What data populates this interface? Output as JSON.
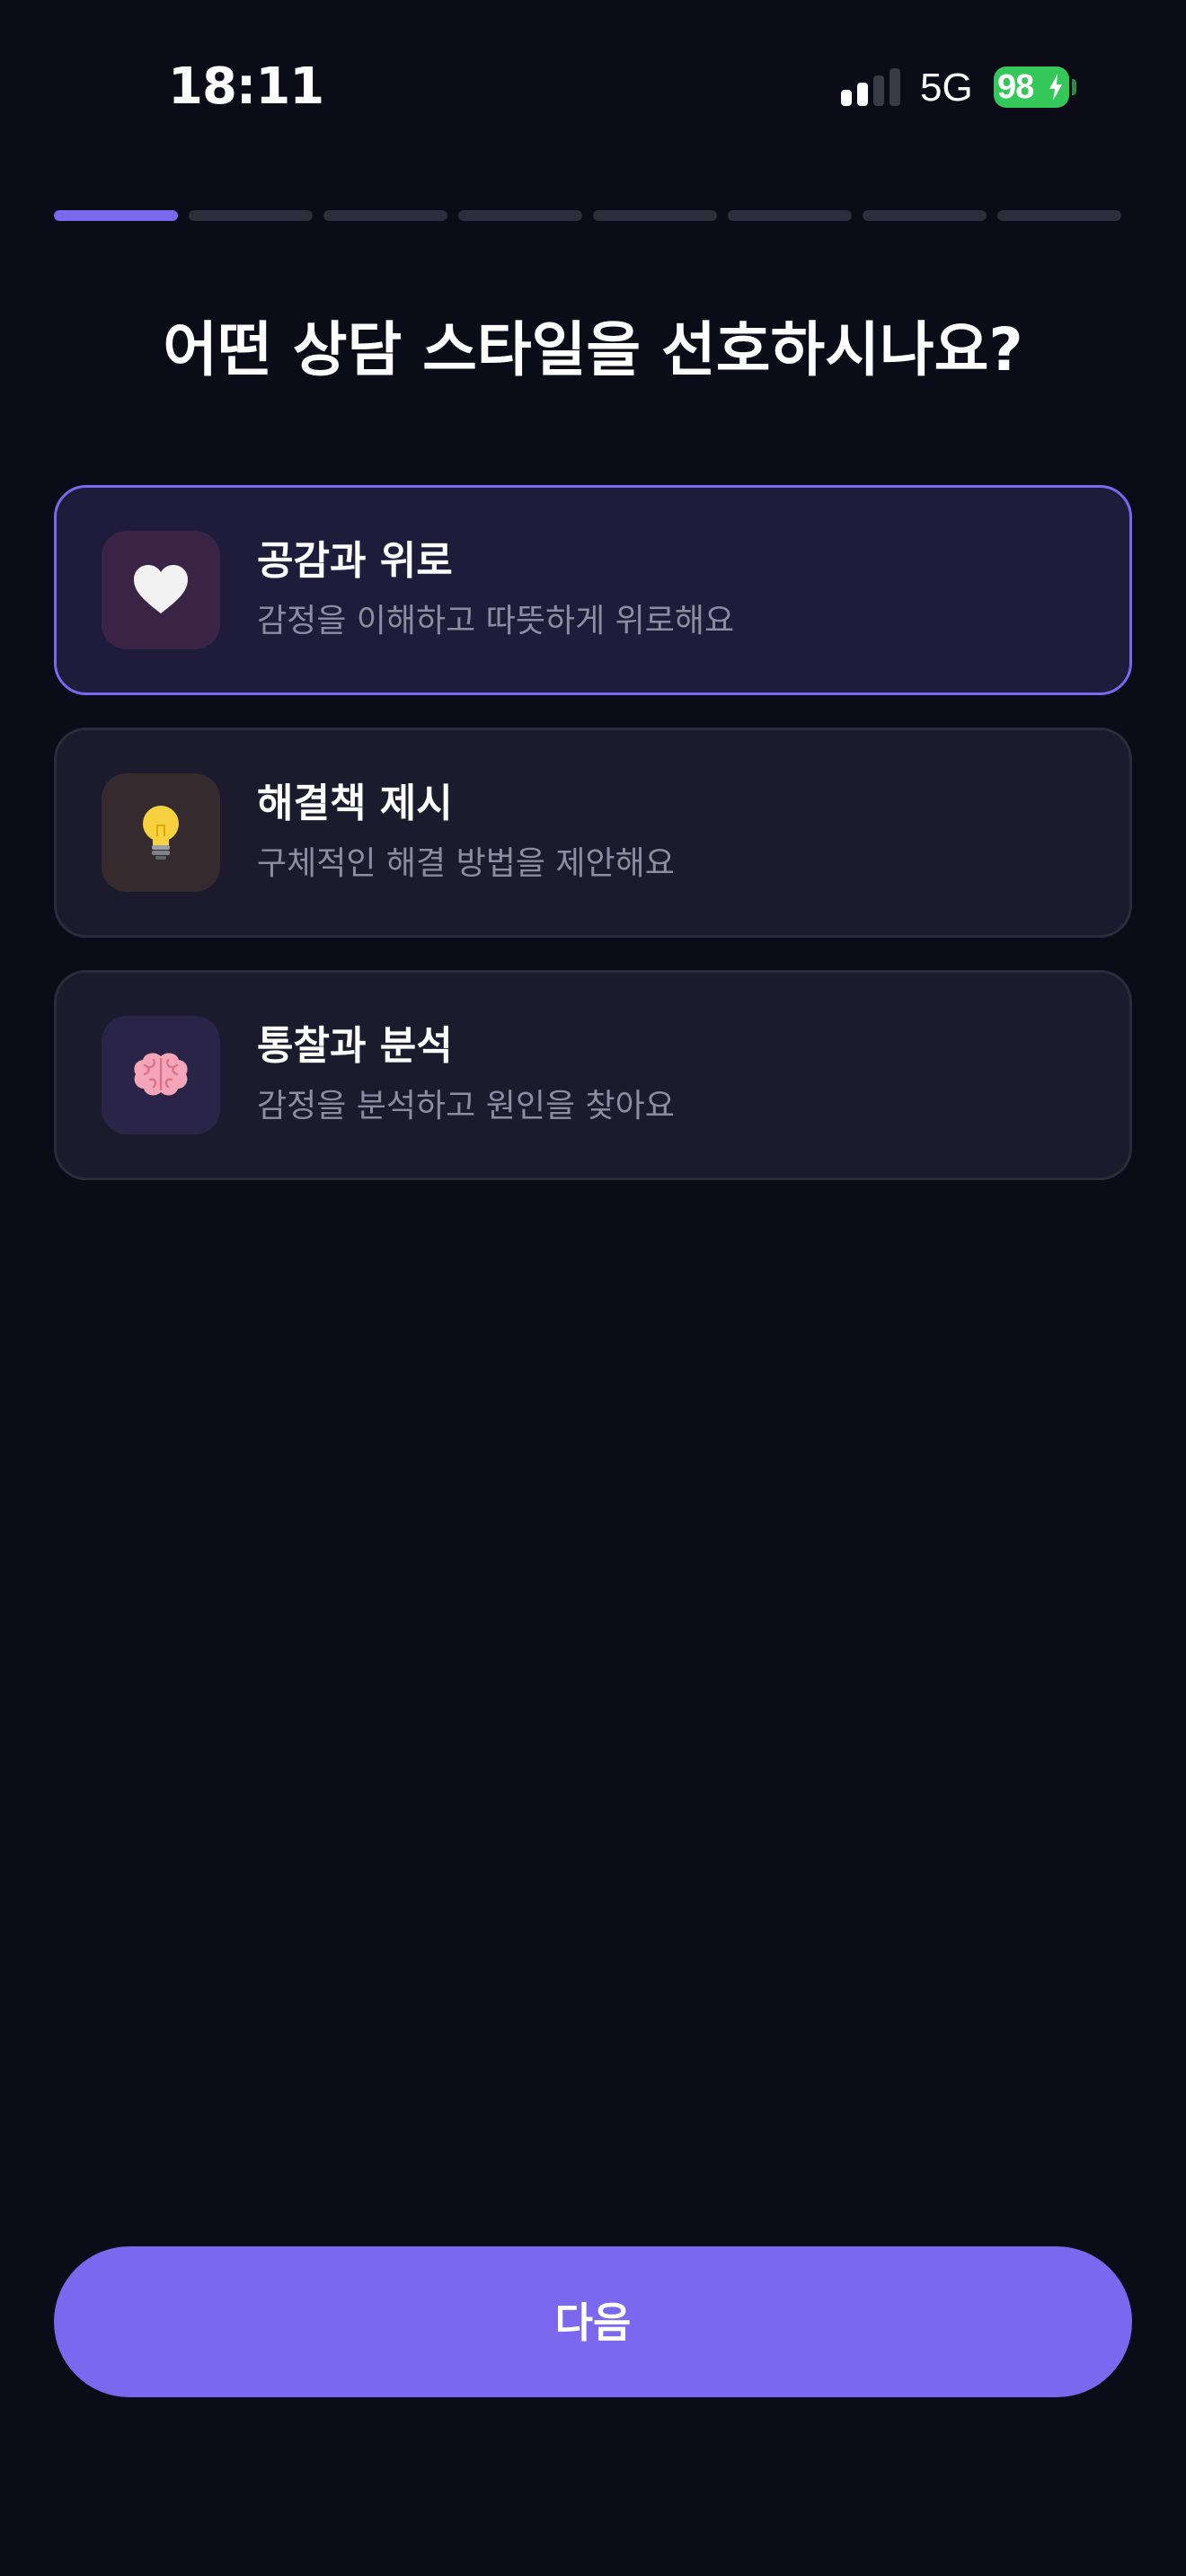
{
  "status_bar": {
    "time": "18:11",
    "network": "5G",
    "battery": "98",
    "signal_bars_active": 2,
    "signal_bars_total": 4
  },
  "progress": {
    "total_steps": 8,
    "current_step": 1
  },
  "question": "어떤 상담 스타일을 선호하시나요?",
  "options": [
    {
      "title": "공감과 위로",
      "description": "감정을 이해하고 따뜻하게 위로해요",
      "icon": "white-heart-icon",
      "icon_glyph": "🤍",
      "icon_bg": "#3a2446",
      "selected": true
    },
    {
      "title": "해결책 제시",
      "description": "구체적인 해결 방법을 제안해요",
      "icon": "light-bulb-icon",
      "icon_glyph": "💡",
      "icon_bg": "#352a2e",
      "selected": false
    },
    {
      "title": "통찰과 분석",
      "description": "감정을 분석하고 원인을 찾아요",
      "icon": "brain-icon",
      "icon_glyph": "🧠",
      "icon_bg": "#2a2548",
      "selected": false
    }
  ],
  "next_button_label": "다음",
  "colors": {
    "accent": "#7b68ee",
    "background": "#0c0b18",
    "battery": "#34c759"
  }
}
